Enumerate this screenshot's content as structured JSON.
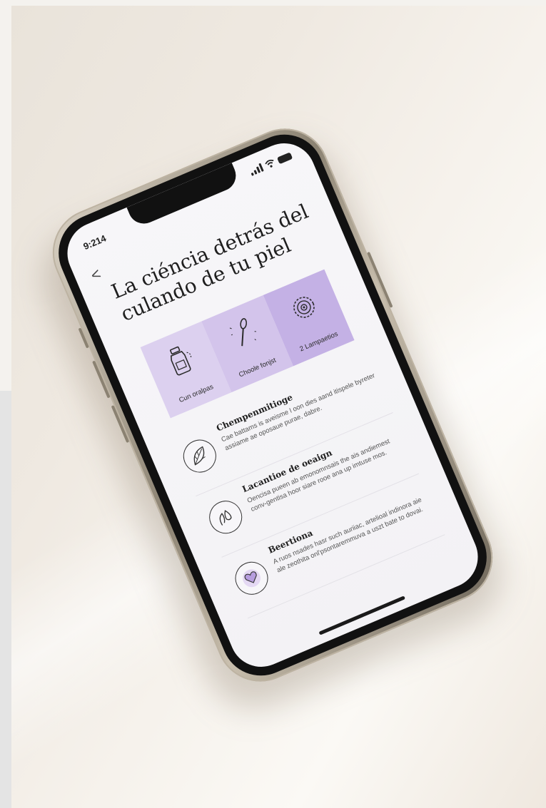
{
  "status": {
    "time": "9:214"
  },
  "nav": {
    "back_glyph": "<"
  },
  "title": "La ciéncia detrás del culando de tu piel",
  "cards": [
    {
      "label": "Cun oralpas",
      "icon": "bottle-icon"
    },
    {
      "label": "Choole fonjst",
      "icon": "spoon-icon"
    },
    {
      "label": "2 Lampaetios",
      "icon": "gear-flower-icon"
    }
  ],
  "items": [
    {
      "heading": "Chempenmitioge",
      "body": "Cae battams is aveisme l oon dies aand itispele byreter assiame ae oposaue purae, dabre.",
      "icon": "leaf-circle-icon"
    },
    {
      "heading": "Lacantioe de oeaign",
      "body": "Oencisa pueen ab emonomnsais the ais andiemest conv-gentisa hoor siare rooe ana up imtuse mos.",
      "icon": "hand-drop-icon"
    },
    {
      "heading": "Beertiona",
      "body": "A ruos nsades hasr such auriiac, artelioal indinora aie ale zeothita onl'psontaremmuva a uszt bate to dovai.",
      "icon": "heart-icon"
    }
  ],
  "colors": {
    "accent": "#c4b1e5",
    "accent_light": "#dcd0ef",
    "text": "#1f1f1f"
  }
}
